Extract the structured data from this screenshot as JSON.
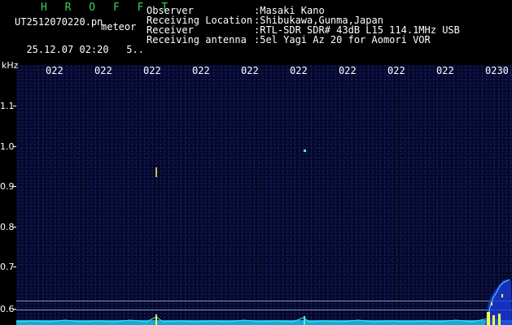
{
  "header": {
    "brand": "H R O F F T",
    "filename": "UT2512070220.pn",
    "meteor_label": "meteor",
    "date": "25.12.07",
    "time": "02:20",
    "index": "5.."
  },
  "info": [
    {
      "key": "Observer",
      "value": ":Masaki Kano"
    },
    {
      "key": "Receiving Location",
      "value": ":Shibukawa,Gunma,Japan"
    },
    {
      "key": "Receiver",
      "value": ":RTL-SDR SDR# 43dB L15 114.1MHz USB"
    },
    {
      "key": "Receiving antenna",
      "value": ":5el Yagi Az 20 for Aomori VOR"
    }
  ],
  "plot": {
    "y_unit": "kHz",
    "y_ticks": [
      "1.1",
      "1.0",
      "0.9",
      "0.8",
      "0.7",
      "0.6"
    ],
    "x_ticks": [
      "022",
      "022",
      "022",
      "022",
      "022",
      "022",
      "022",
      "022",
      "022",
      "0230"
    ],
    "colors": {
      "background": "#060826",
      "noise": "#2838d8",
      "signal": "#ffff40",
      "baseline": "#20e8f0"
    }
  }
}
